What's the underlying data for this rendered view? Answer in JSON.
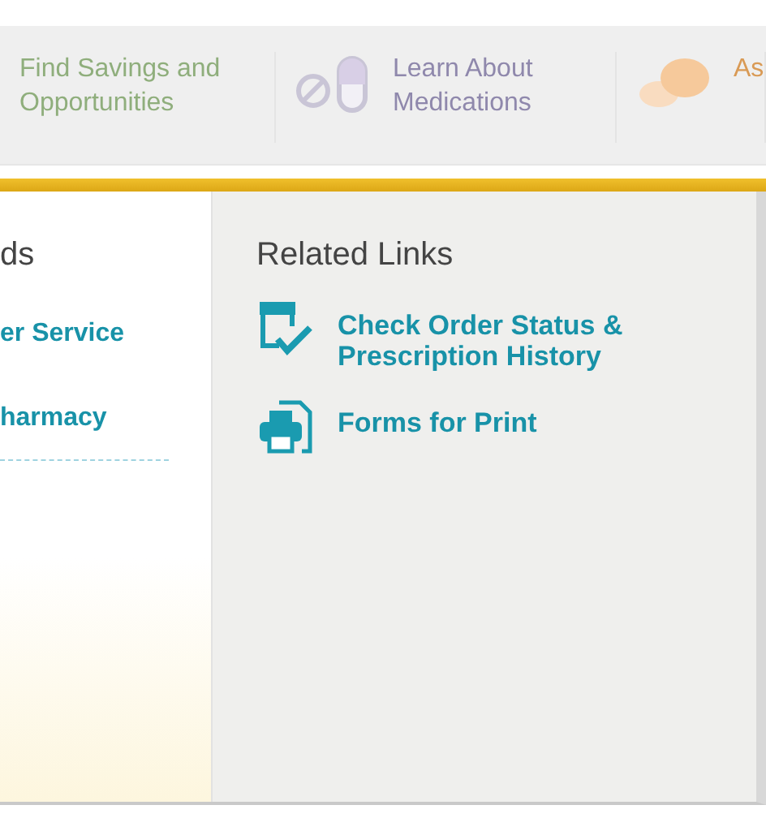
{
  "nav": [
    {
      "kind": "text",
      "label": "Find Savings and Opportunities"
    },
    {
      "kind": "pill",
      "label": "Learn About Medications"
    },
    {
      "kind": "rx",
      "label": "As"
    }
  ],
  "left": {
    "heading": "ds",
    "links": [
      "er Service",
      "harmacy"
    ]
  },
  "right": {
    "heading": "Related Links",
    "links": [
      {
        "kind": "order",
        "label": "Check Order Status & Prescription History"
      },
      {
        "kind": "print",
        "label": "Forms for Print"
      }
    ]
  }
}
